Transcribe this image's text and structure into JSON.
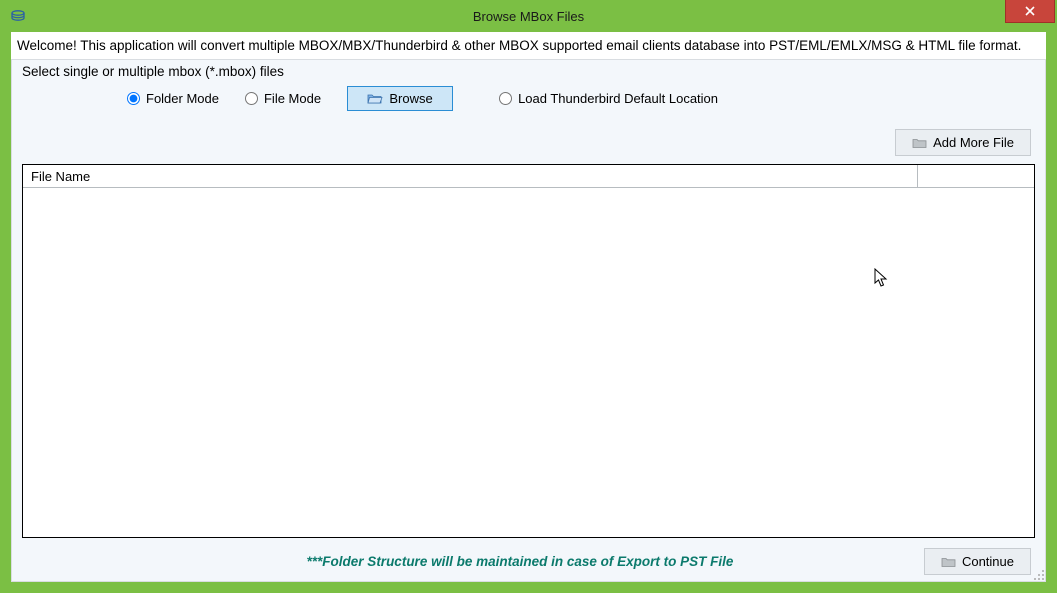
{
  "window": {
    "title": "Browse MBox Files"
  },
  "welcome_text": "Welcome! This application will convert multiple MBOX/MBX/Thunderbird & other MBOX supported email clients database into PST/EML/EMLX/MSG & HTML file format.",
  "panel": {
    "title": "Select single or multiple mbox (*.mbox) files",
    "modes": {
      "folder_label": "Folder Mode",
      "file_label": "File Mode",
      "selected": "folder"
    },
    "browse_label": "Browse",
    "thunderbird_label": "Load Thunderbird Default Location",
    "add_more_label": "Add More File",
    "list": {
      "header_filename": "File Name",
      "rows": []
    },
    "footer_note": "***Folder Structure will be maintained in case of Export to PST File",
    "continue_label": "Continue"
  }
}
